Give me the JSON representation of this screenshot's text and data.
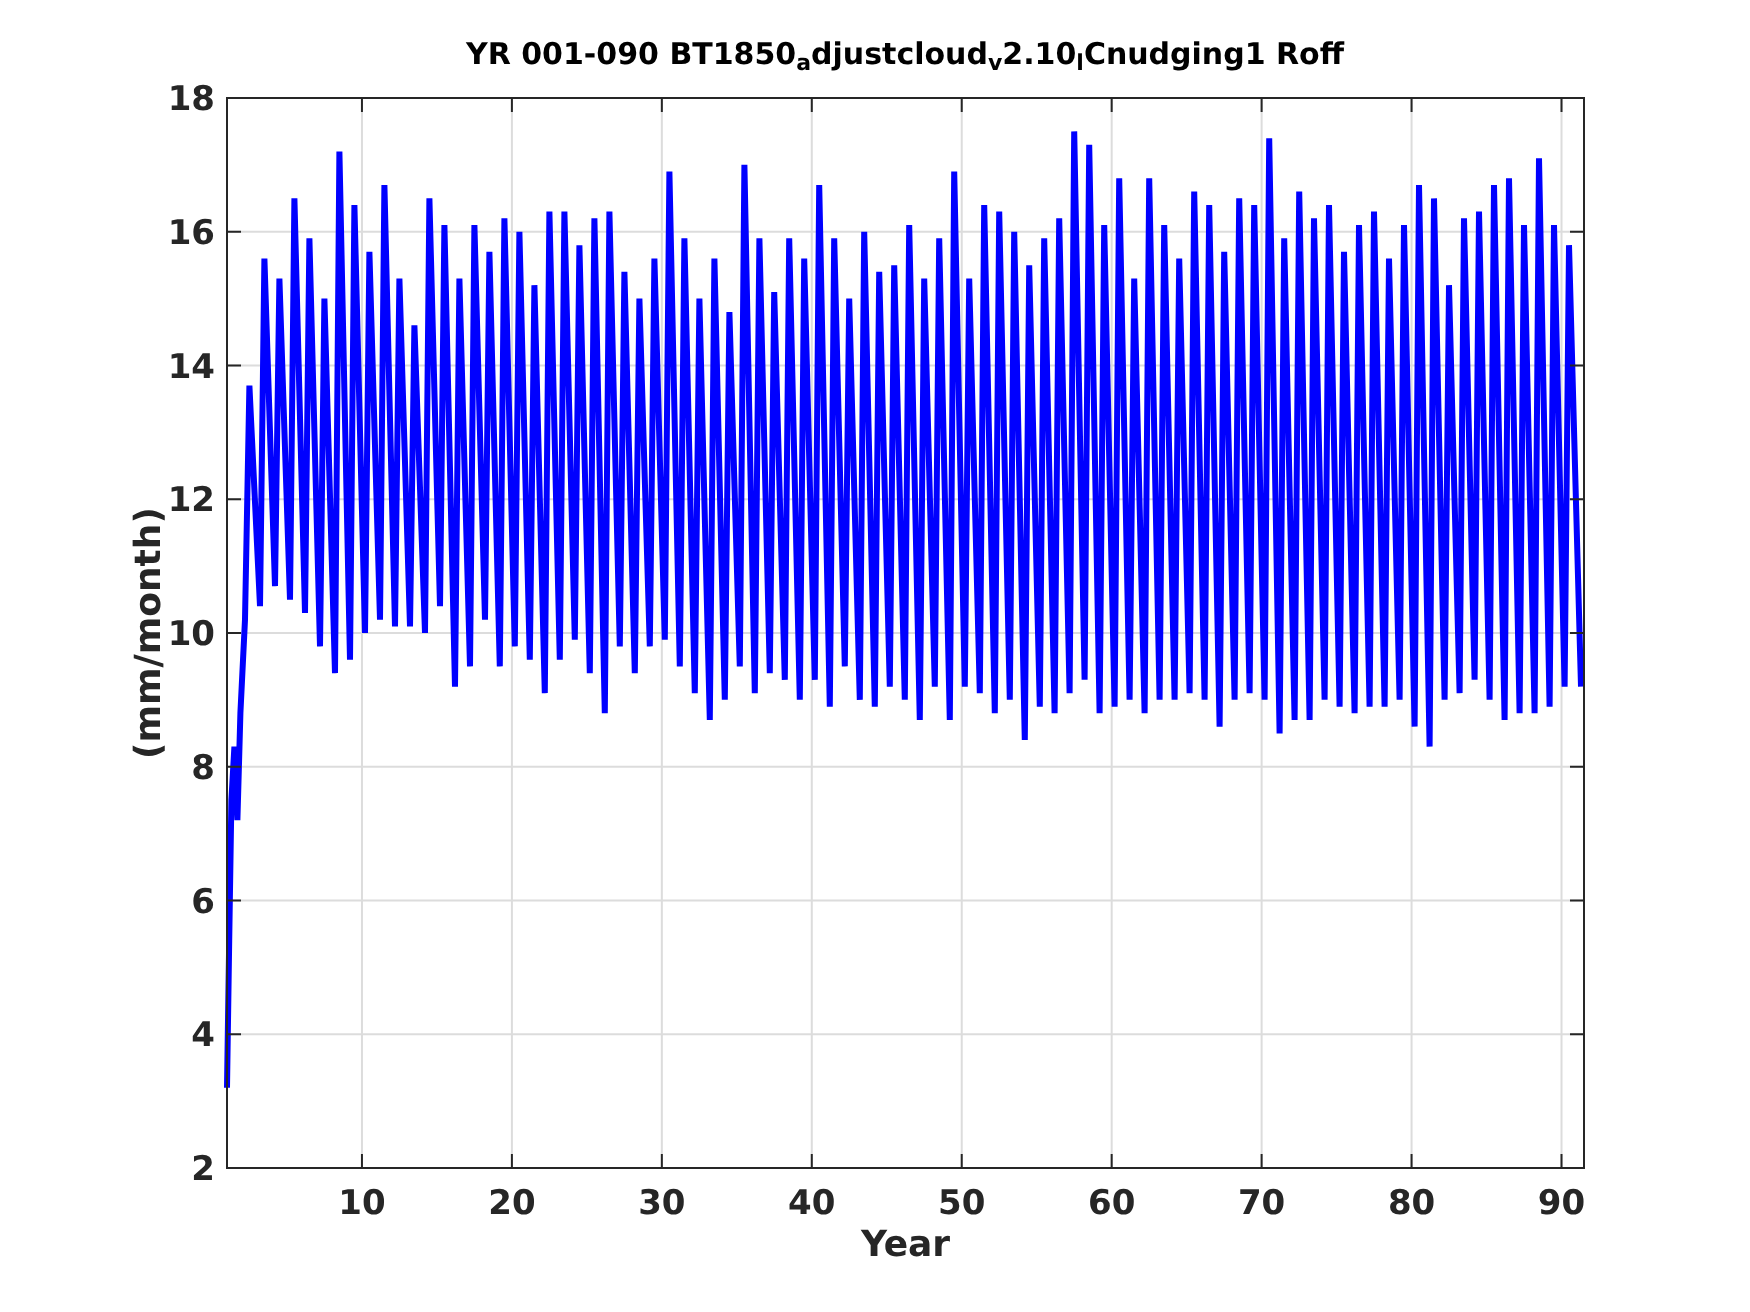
{
  "figure": {
    "chart_data": {
      "type": "line",
      "title": "YR 001-090 BT1850$_{a}$djustcloud$_{v}$2.10$_{l}$Cnudging1 Roff",
      "xlabel": "Year",
      "ylabel": "(mm/month)",
      "xlim": [
        1,
        91.5
      ],
      "ylim": [
        2,
        18
      ],
      "grid": true,
      "xticks": [
        10,
        20,
        30,
        40,
        50,
        60,
        70,
        80,
        90
      ],
      "yticks": [
        2,
        4,
        6,
        8,
        10,
        12,
        14,
        16,
        18
      ],
      "series": [
        {
          "color": "#0000ff",
          "x": [
            1.0,
            1.15,
            1.3,
            1.5,
            1.7,
            1.9,
            2.2,
            2.5,
            3.2,
            3.5,
            4.2,
            4.5,
            5.2,
            5.5,
            6.2,
            6.5,
            7.2,
            7.5,
            8.2,
            8.5,
            9.2,
            9.5,
            10.2,
            10.5,
            11.2,
            11.5,
            12.2,
            12.5,
            13.2,
            13.5,
            14.2,
            14.5,
            15.2,
            15.5,
            16.2,
            16.5,
            17.2,
            17.5,
            18.2,
            18.5,
            19.2,
            19.5,
            20.2,
            20.5,
            21.2,
            21.5,
            22.2,
            22.5,
            23.2,
            23.5,
            24.2,
            24.5,
            25.2,
            25.5,
            26.2,
            26.5,
            27.2,
            27.5,
            28.2,
            28.5,
            29.2,
            29.5,
            30.2,
            30.5,
            31.2,
            31.5,
            32.2,
            32.5,
            33.2,
            33.5,
            34.2,
            34.5,
            35.2,
            35.5,
            36.2,
            36.5,
            37.2,
            37.5,
            38.2,
            38.5,
            39.2,
            39.5,
            40.2,
            40.5,
            41.2,
            41.5,
            42.2,
            42.5,
            43.2,
            43.5,
            44.2,
            44.5,
            45.2,
            45.5,
            46.2,
            46.5,
            47.2,
            47.5,
            48.2,
            48.5,
            49.2,
            49.5,
            50.2,
            50.5,
            51.2,
            51.5,
            52.2,
            52.5,
            53.2,
            53.5,
            54.2,
            54.5,
            55.2,
            55.5,
            56.2,
            56.5,
            57.2,
            57.5,
            58.2,
            58.5,
            59.2,
            59.5,
            60.2,
            60.5,
            61.2,
            61.5,
            62.2,
            62.5,
            63.2,
            63.5,
            64.2,
            64.5,
            65.2,
            65.5,
            66.2,
            66.5,
            67.2,
            67.5,
            68.2,
            68.5,
            69.2,
            69.5,
            70.2,
            70.5,
            71.2,
            71.5,
            72.2,
            72.5,
            73.2,
            73.5,
            74.2,
            74.5,
            75.2,
            75.5,
            76.2,
            76.5,
            77.2,
            77.5,
            78.2,
            78.5,
            79.2,
            79.5,
            80.2,
            80.5,
            81.2,
            81.5,
            82.2,
            82.5,
            83.2,
            83.5,
            84.2,
            84.5,
            85.2,
            85.5,
            86.2,
            86.5,
            87.2,
            87.5,
            88.2,
            88.5,
            89.2,
            89.5,
            90.2,
            90.5,
            91.3
          ],
          "values": [
            3.2,
            5.4,
            7.5,
            8.3,
            7.2,
            8.8,
            10.2,
            13.7,
            10.4,
            15.6,
            10.7,
            15.3,
            10.5,
            16.5,
            10.3,
            15.9,
            9.8,
            15.0,
            9.4,
            17.2,
            9.6,
            16.4,
            10.0,
            15.7,
            10.2,
            16.7,
            10.1,
            15.3,
            10.1,
            14.6,
            10.0,
            16.5,
            10.4,
            16.1,
            9.2,
            15.3,
            9.5,
            16.1,
            10.2,
            15.7,
            9.5,
            16.2,
            9.8,
            16.0,
            9.6,
            15.2,
            9.1,
            16.3,
            9.6,
            16.3,
            9.9,
            15.8,
            9.4,
            16.2,
            8.8,
            16.3,
            9.8,
            15.4,
            9.4,
            15.0,
            9.8,
            15.6,
            9.9,
            16.9,
            9.5,
            15.9,
            9.1,
            15.0,
            8.7,
            15.6,
            9.0,
            14.8,
            9.5,
            17.0,
            9.1,
            15.9,
            9.4,
            15.1,
            9.3,
            15.9,
            9.0,
            15.6,
            9.3,
            16.7,
            8.9,
            15.9,
            9.5,
            15.0,
            9.0,
            16.0,
            8.9,
            15.4,
            9.2,
            15.5,
            9.0,
            16.1,
            8.7,
            15.3,
            9.2,
            15.9,
            8.7,
            16.9,
            9.2,
            15.3,
            9.1,
            16.4,
            8.8,
            16.3,
            9.0,
            16.0,
            8.4,
            15.5,
            8.9,
            15.9,
            8.8,
            16.2,
            9.1,
            17.5,
            9.3,
            17.3,
            8.8,
            16.1,
            8.9,
            16.8,
            9.0,
            15.3,
            8.8,
            16.8,
            9.0,
            16.1,
            9.0,
            15.6,
            9.1,
            16.6,
            9.0,
            16.4,
            8.6,
            15.7,
            9.0,
            16.5,
            9.1,
            16.4,
            9.0,
            17.4,
            8.5,
            15.9,
            8.7,
            16.6,
            8.7,
            16.2,
            9.0,
            16.4,
            8.9,
            15.7,
            8.8,
            16.1,
            8.9,
            16.3,
            8.9,
            15.6,
            9.0,
            16.1,
            8.6,
            16.7,
            8.3,
            16.5,
            9.0,
            15.2,
            9.1,
            16.2,
            9.3,
            16.3,
            9.0,
            16.7,
            8.7,
            16.8,
            8.8,
            16.1,
            8.8,
            17.1,
            8.9,
            16.1,
            9.2,
            15.8,
            9.2
          ]
        }
      ]
    }
  }
}
